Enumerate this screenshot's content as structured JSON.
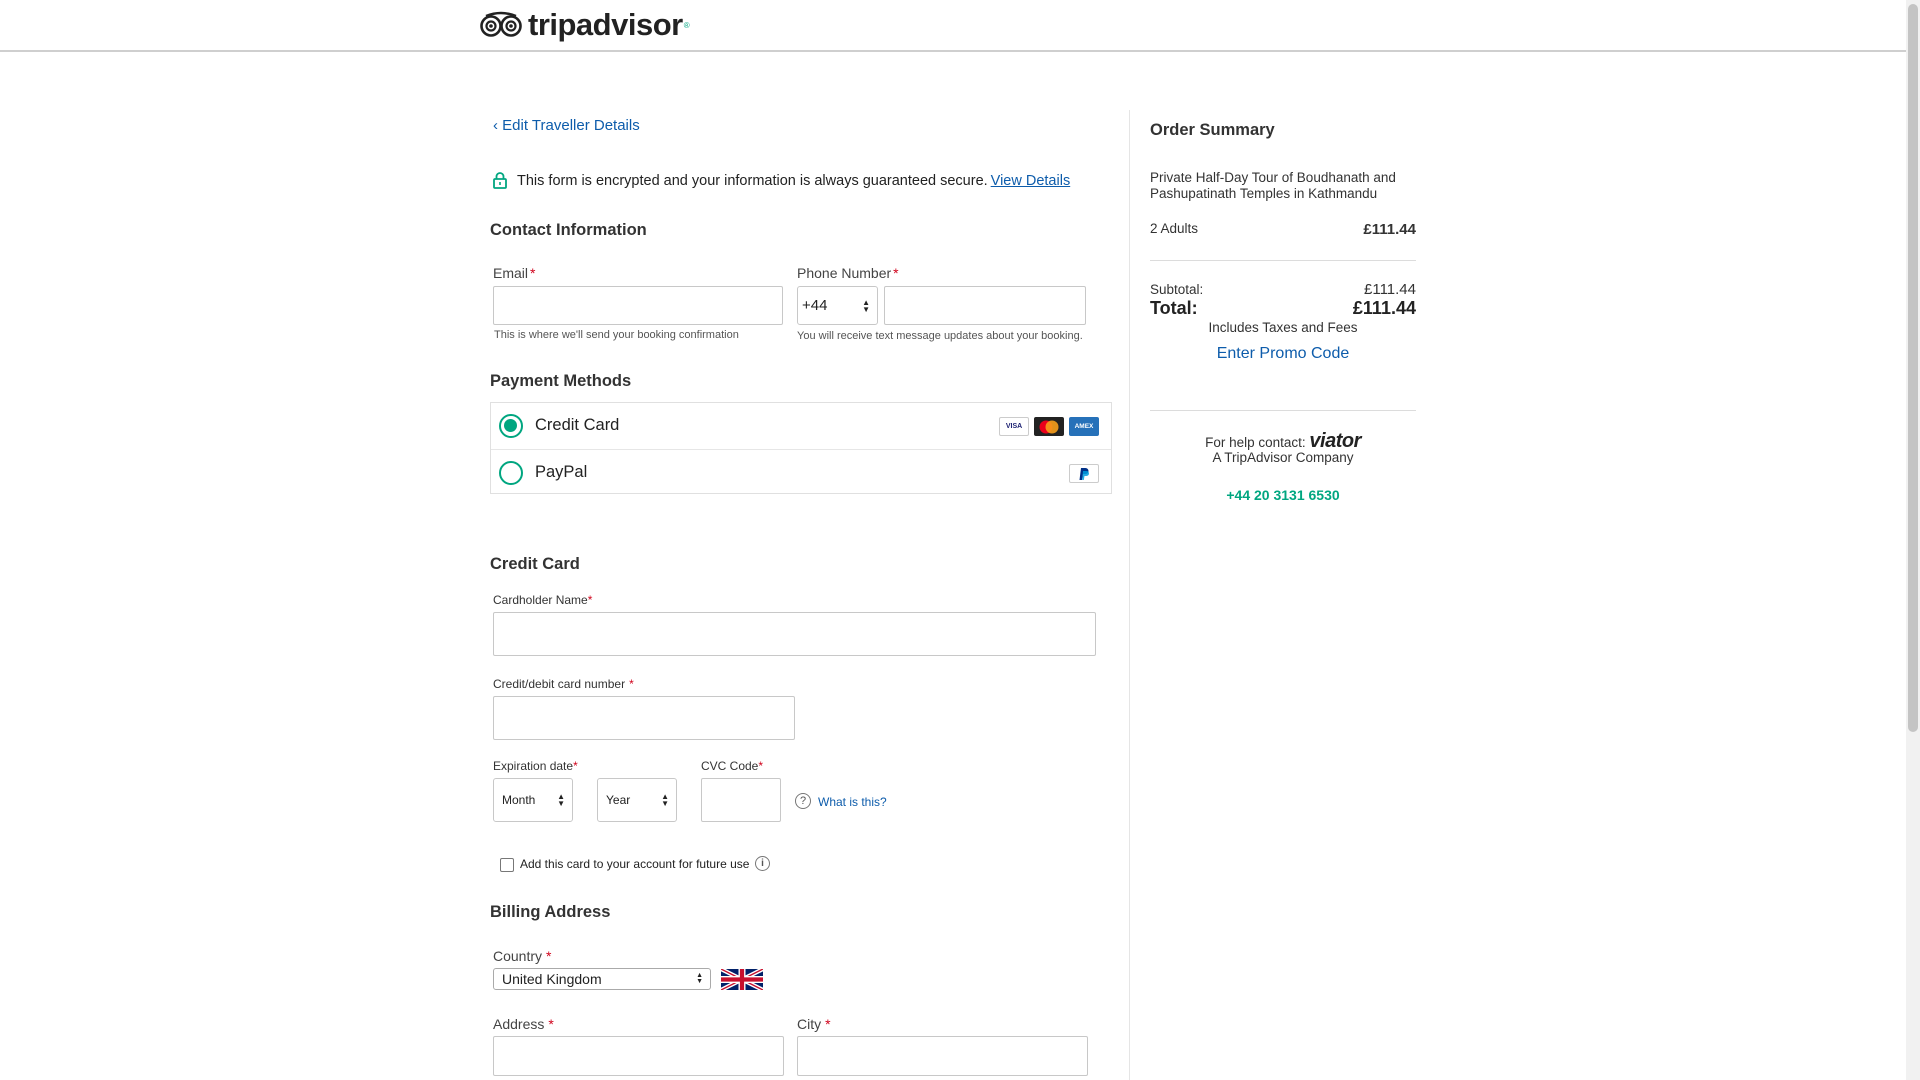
{
  "header": {
    "brand": "tripadvisor",
    "brand_mark": "®"
  },
  "nav": {
    "back_link": "‹ Edit Traveller Details"
  },
  "secure_notice": {
    "text": "This form is encrypted and your information is always guaranteed secure.",
    "link": "View Details"
  },
  "contact": {
    "title": "Contact Information",
    "email_label": "Email",
    "email_help": "This is where we'll send your booking confirmation",
    "phone_label": "Phone Number",
    "phone_code": "+44",
    "phone_help": "You will receive text message updates about your booking.",
    "required_mark": "*"
  },
  "payment_methods": {
    "title": "Payment Methods",
    "options": [
      {
        "label": "Credit Card",
        "selected": true
      },
      {
        "label": "PayPal",
        "selected": false
      }
    ],
    "card_brands": [
      "VISA",
      "AMEX"
    ]
  },
  "credit_card": {
    "title": "Credit Card",
    "cardholder_label": "Cardholder Name",
    "number_label": "Credit/debit card number",
    "expiry_label": "Expiration date",
    "month_value": "Month",
    "year_value": "Year",
    "cvc_label": "CVC Code",
    "cvc_help_link": "What is this?",
    "save_card_label": "Add this card to your account for future use"
  },
  "billing": {
    "title": "Billing Address",
    "country_label": "Country",
    "country_value": "United Kingdom",
    "address_label": "Address",
    "city_label": "City"
  },
  "order_summary": {
    "title": "Order Summary",
    "product_line1": "Private Half-Day Tour of Boudhanath and",
    "product_line2": "Pashupatinath Temples in Kathmandu",
    "adults_label": "2 Adults",
    "adults_amount": "£111.44",
    "subtotal_label": "Subtotal:",
    "subtotal_amount": "£111.44",
    "total_label": "Total:",
    "total_amount": "£111.44",
    "taxes_note": "Includes Taxes and Fees",
    "promo_link": "Enter Promo Code",
    "help_label": "For help contact:",
    "help_brand": "viator",
    "help_company": "A TripAdvisor Company",
    "help_phone": "+44 20 3131 6530"
  },
  "colors": {
    "brand_green": "#00a680",
    "link_blue": "#0d5cab",
    "required_red": "#d0021b"
  }
}
